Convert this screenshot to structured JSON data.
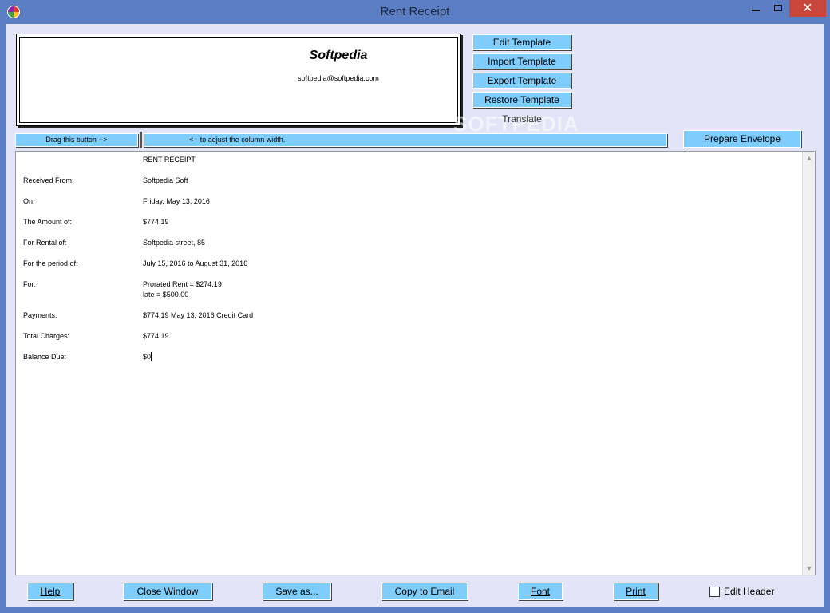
{
  "window": {
    "title": "Rent Receipt",
    "minimize_glyph": "",
    "maximize_glyph": "",
    "close_glyph": "✕",
    "app_icon": "color-wheel-icon"
  },
  "header": {
    "company": "Softpedia",
    "email": "softpedia@softpedia.com"
  },
  "template_buttons": {
    "edit": "Edit Template",
    "import": "Import Template",
    "export": "Export Template",
    "restore": "Restore Template",
    "translate": "Translate"
  },
  "watermark": "SOFTPEDIA",
  "column_bar": {
    "drag_label": "Drag this button -->",
    "hint": "<-- to adjust the column width."
  },
  "prepare_envelope": "Prepare Envelope",
  "receipt": {
    "title": "RENT RECEIPT",
    "rows": [
      {
        "label": "Received From:",
        "value": "Softpedia Soft"
      },
      {
        "label": "On:",
        "value": "Friday, May 13, 2016"
      },
      {
        "label": "The Amount of:",
        "value": "$774.19"
      },
      {
        "label": "For Rental of:",
        "value": "Softpedia street, 85"
      },
      {
        "label": "For the period of:",
        "value": "July 15, 2016 to August 31, 2016"
      },
      {
        "label": "For:",
        "value": "Prorated Rent = $274.19",
        "value2": "late = $500.00"
      },
      {
        "label": "Payments:",
        "value": "$774.19 May 13, 2016 Credit Card"
      },
      {
        "label": "Total Charges:",
        "value": "$774.19"
      },
      {
        "label": "Balance Due:",
        "value": "$0"
      }
    ]
  },
  "bottom_buttons": {
    "help": "Help",
    "close_window": "Close Window",
    "save_as": "Save as...",
    "copy_email": "Copy to Email",
    "font": "Font",
    "print": "Print"
  },
  "edit_header": {
    "label": "Edit Header",
    "checked": false
  },
  "colors": {
    "titlebar": "#5b7ec4",
    "client": "#e4e4f8",
    "button": "#7fcdfd",
    "close": "#c9463d"
  }
}
